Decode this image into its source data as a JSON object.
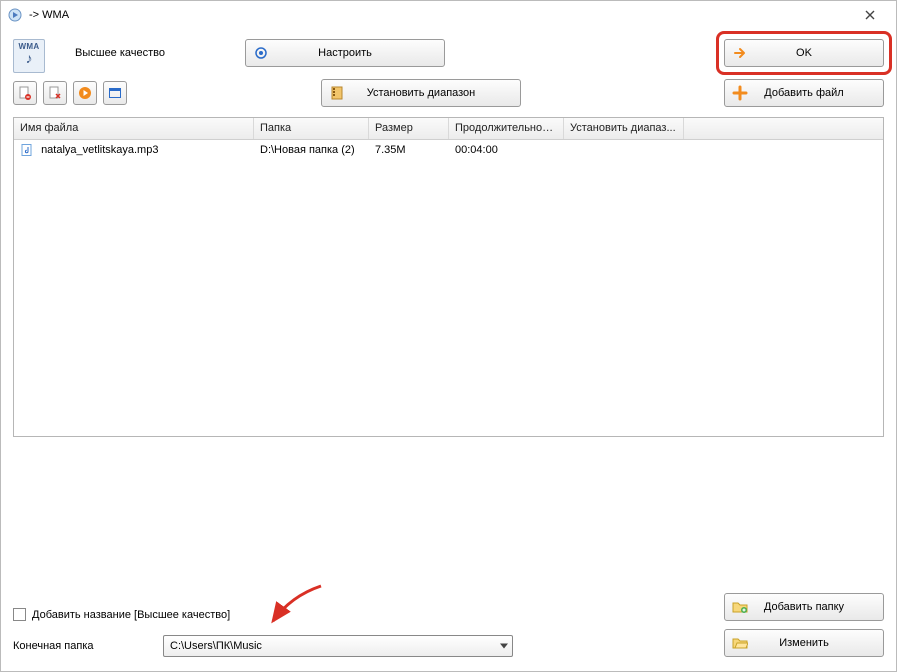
{
  "titlebar": {
    "title": "  -> WMA"
  },
  "top": {
    "wma_badge": "WMA",
    "quality_label": "Высшее качество",
    "configure_label": "Настроить",
    "ok_label": "OK"
  },
  "row1": {
    "setrange_label": "Установить диапазон",
    "addfile_label": "Добавить файл"
  },
  "table": {
    "headers": {
      "name": "Имя файла",
      "folder": "Папка",
      "size": "Размер",
      "duration": "Продолжительность",
      "range": "Установить диапаз..."
    },
    "rows": [
      {
        "name": "natalya_vetlitskaya.mp3",
        "folder": "D:\\Новая папка (2)",
        "size": "7.35M",
        "duration": "00:04:00",
        "range": ""
      }
    ]
  },
  "bottom": {
    "addname_label": "Добавить название [Высшее качество]",
    "outfolder_label": "Конечная папка",
    "outfolder_value": "C:\\Users\\ПК\\Music",
    "addfolder_label": "Добавить папку",
    "change_label": "Изменить"
  }
}
